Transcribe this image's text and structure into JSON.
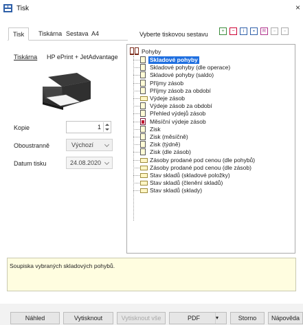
{
  "window": {
    "title": "Tisk",
    "close_glyph": "×"
  },
  "tabs": [
    {
      "label": "Tisk"
    },
    {
      "label": "Tiskárna"
    },
    {
      "label": "Sestava"
    },
    {
      "label": "A4"
    }
  ],
  "report_select_label": "Vyberte tiskovou sestavu",
  "toolbar_icons": [
    {
      "name": "add-green-icon",
      "glyph": "+"
    },
    {
      "name": "remove-red-icon",
      "glyph": "−"
    },
    {
      "name": "info-blue-icon",
      "glyph": "i"
    },
    {
      "name": "edit-blue-icon",
      "glyph": "▪"
    },
    {
      "name": "report-pink-icon",
      "glyph": "R"
    },
    {
      "name": "export-gray-icon",
      "glyph": "▫"
    },
    {
      "name": "settings-gray-icon",
      "glyph": "▫"
    }
  ],
  "printer": {
    "label": "Tiskárna",
    "name": "HP ePrint + JetAdvantage"
  },
  "form": {
    "copies_label": "Kopie",
    "copies_value": "1",
    "duplex_label": "Oboustranně",
    "duplex_value": "Výchozí",
    "date_label": "Datum tisku",
    "date_value": "24.08.2020"
  },
  "tree": {
    "root_label": "Pohyby",
    "items": [
      {
        "label": "Skladové pohyby",
        "icon": "document",
        "selected": true
      },
      {
        "label": "Skladové pohyby (dle operace)",
        "icon": "document"
      },
      {
        "label": "Skladové pohyby (saldo)",
        "icon": "document"
      },
      {
        "label": "Příjmy zásob",
        "icon": "document"
      },
      {
        "label": "Příjmy zásob za období",
        "icon": "document"
      },
      {
        "label": "Výdeje zásob",
        "icon": "folder"
      },
      {
        "label": "Výdeje zásob za období",
        "icon": "document"
      },
      {
        "label": "Přehled výdejů zásob",
        "icon": "document"
      },
      {
        "label": "Měsíční výdeje zásob",
        "icon": "chart"
      },
      {
        "label": "Zisk",
        "icon": "document"
      },
      {
        "label": "Zisk (měsíčně)",
        "icon": "document"
      },
      {
        "label": "Zisk (týdně)",
        "icon": "document"
      },
      {
        "label": "Zisk (dle zásob)",
        "icon": "document"
      },
      {
        "label": "Zásoby prodané pod cenou (dle pohybů)",
        "icon": "folder"
      },
      {
        "label": "Zásoby prodané pod cenou (dle zásob)",
        "icon": "folder"
      },
      {
        "label": "Stav skladů (skladové položky)",
        "icon": "folder"
      },
      {
        "label": "Stav skladů (členění skladů)",
        "icon": "folder"
      },
      {
        "label": "Stav skladů (sklady)",
        "icon": "folder"
      }
    ]
  },
  "description": "Soupiska vybraných skladových pohybů.",
  "buttons": {
    "preview": "Náhled",
    "print": "Vytisknout",
    "print_all": "Vytisknout vše",
    "pdf": "PDF",
    "pdf_caret": "▾",
    "cancel": "Storno",
    "help": "Nápověda"
  }
}
